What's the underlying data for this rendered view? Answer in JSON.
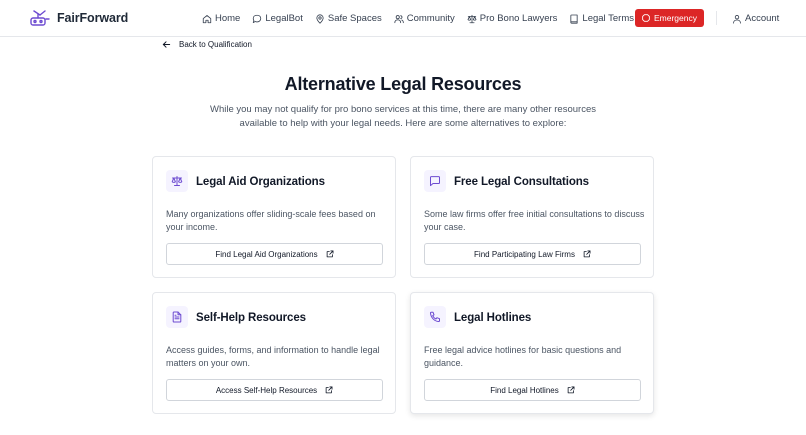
{
  "brand": {
    "name": "FairForward"
  },
  "nav": {
    "items": [
      {
        "label": "Home",
        "icon": "home-icon"
      },
      {
        "label": "LegalBot",
        "icon": "chat-icon"
      },
      {
        "label": "Safe Spaces",
        "icon": "map-pin-icon"
      },
      {
        "label": "Community",
        "icon": "users-icon"
      },
      {
        "label": "Pro Bono Lawyers",
        "icon": "scale-icon"
      },
      {
        "label": "Legal Terms",
        "icon": "book-icon"
      }
    ],
    "emergency_label": "Emergency",
    "account_label": "Account"
  },
  "page": {
    "back_label": "Back to Qualification",
    "title": "Alternative Legal Resources",
    "subtitle": "While you may not qualify for pro bono services at this time, there are many other resources available to help with your legal needs. Here are some alternatives to explore:"
  },
  "cards": [
    {
      "title": "Legal Aid Organizations",
      "icon": "scale-icon",
      "description": "Many organizations offer sliding-scale fees based on your income.",
      "button": "Find Legal Aid Organizations"
    },
    {
      "title": "Free Legal Consultations",
      "icon": "message-square-icon",
      "description": "Some law firms offer free initial consultations to discuss your case.",
      "button": "Find Participating Law Firms"
    },
    {
      "title": "Self-Help Resources",
      "icon": "file-text-icon",
      "description": "Access guides, forms, and information to handle legal matters on your own.",
      "button": "Access Self-Help Resources"
    },
    {
      "title": "Legal Hotlines",
      "icon": "phone-icon",
      "description": "Free legal advice hotlines for basic questions and guidance.",
      "button": "Find Legal Hotlines"
    }
  ],
  "colors": {
    "accent": "#6d4bd1",
    "emergency": "#dc2626",
    "icon_bg": "#f5f3ff"
  }
}
